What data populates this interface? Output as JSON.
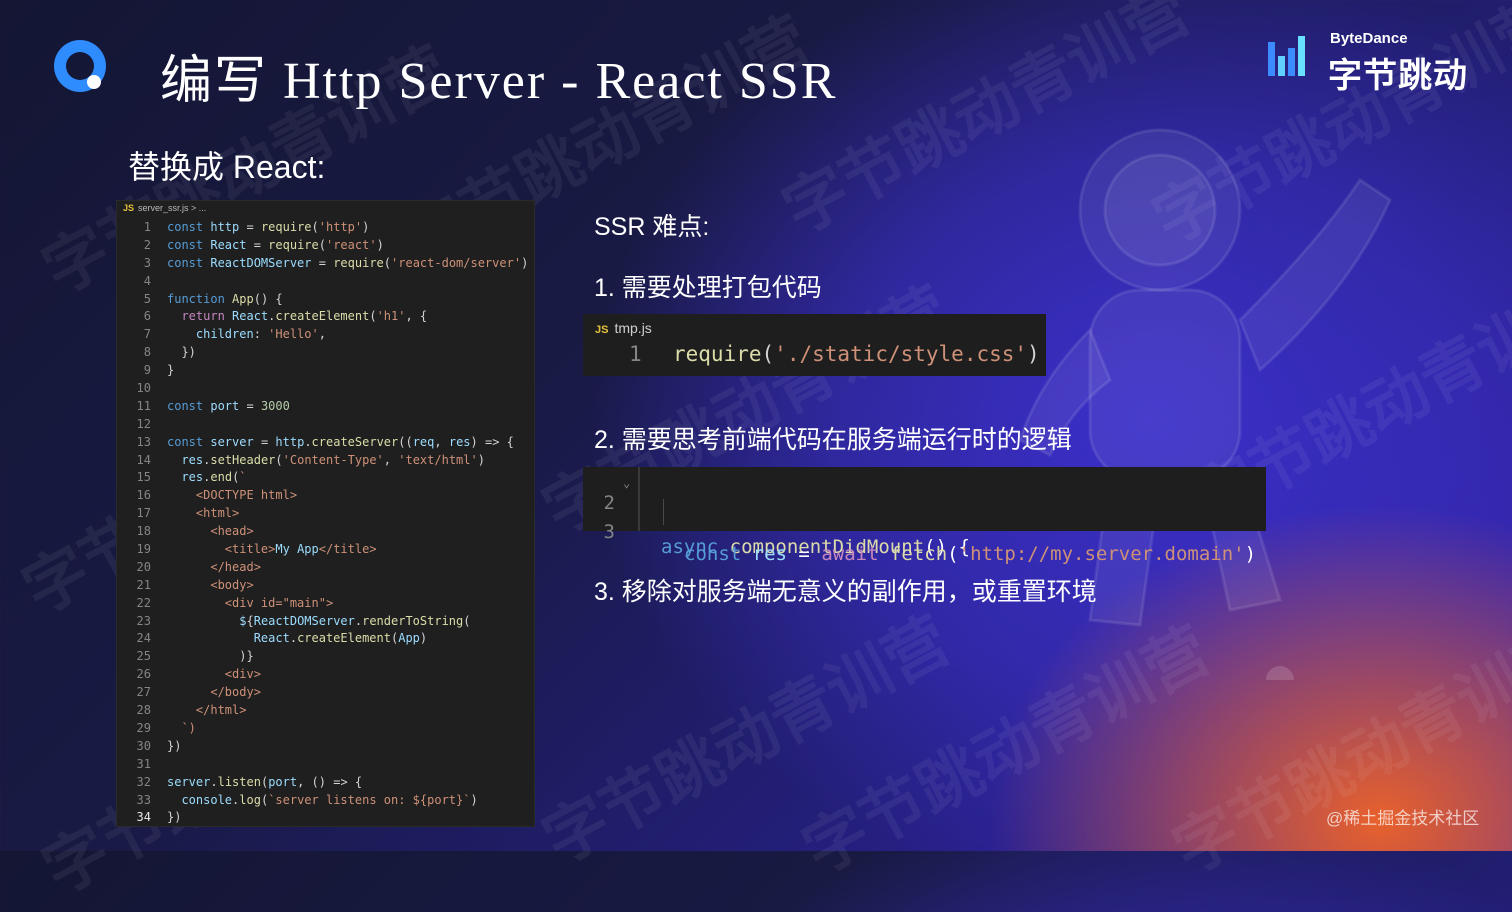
{
  "header": {
    "title": "编写 Http Server -  React SSR",
    "brand_en": "ByteDance",
    "brand_cn": "字节跳动"
  },
  "subtitle": "替换成 React:",
  "editor": {
    "breadcrumb_icon": "JS",
    "breadcrumb": "server_ssr.js > ...",
    "active_line": 34,
    "lines": [
      "const http = require('http')",
      "const React = require('react')",
      "const ReactDOMServer = require('react-dom/server')",
      "",
      "function App() {",
      "  return React.createElement('h1', {",
      "    children: 'Hello',",
      "  })",
      "}",
      "",
      "const port = 3000",
      "",
      "const server = http.createServer((req, res) => {",
      "  res.setHeader('Content-Type', 'text/html')",
      "  res.end(`",
      "    <DOCTYPE html>",
      "    <html>",
      "      <head>",
      "        <title>My App</title>",
      "      </head>",
      "      <body>",
      "        <div id=\"main\">",
      "          ${ReactDOMServer.renderToString(",
      "            React.createElement(App)",
      "          )}",
      "        <div>",
      "      </body>",
      "    </html>",
      "  `)",
      "})",
      "",
      "server.listen(port, () => {",
      "  console.log(`server listens on: ${port}`)",
      "})"
    ]
  },
  "difficulties": {
    "heading": "SSR 难点:",
    "item1": "1. 需要处理打包代码",
    "snippet1": {
      "tab_icon": "JS",
      "tab": "tmp.js",
      "line_no": "1",
      "code": "require('./static/style.css')"
    },
    "item2": "2. 需要思考前端代码在服务端运行时的逻辑",
    "snippet2": {
      "line2_no": "2",
      "line2_code": "async componentDidMount() {",
      "line3_no": "3",
      "line3_code": "const res = await fetch('http://my.server.domain')"
    },
    "item3": "3. 移除对服务端无意义的副作用，或重置环境"
  },
  "footer": "@稀土掘金技术社区",
  "watermark": "字节跳动青训营",
  "colors": {
    "accent_blue": "#2f8cff",
    "brand_blue": "#3c8cff",
    "editor_bg": "#1f1f1f"
  }
}
